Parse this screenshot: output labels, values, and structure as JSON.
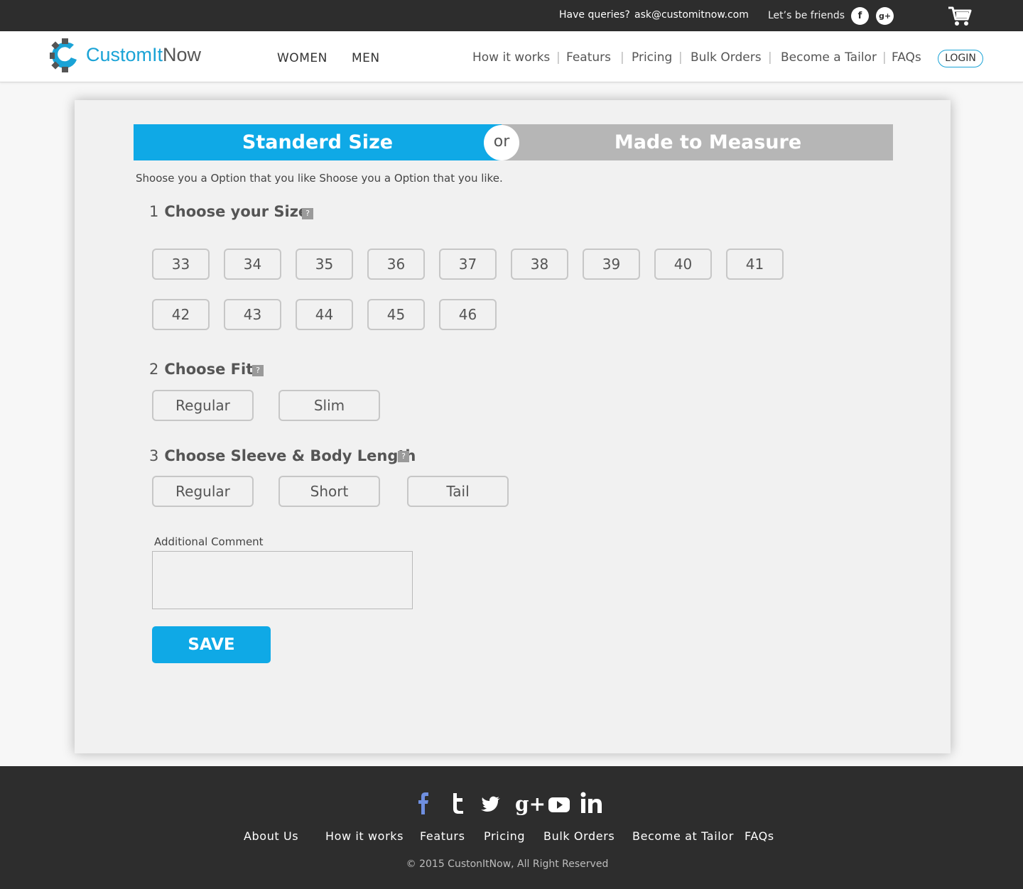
{
  "topbar": {
    "queries_label": "Have queries?",
    "email": "ask@customitnow.com",
    "friends_label": "Let’s be friends",
    "facebook_glyph": "f",
    "gplus_glyph": "g+"
  },
  "header": {
    "logo_part1": "CustomIt",
    "logo_part2": "Now",
    "gender": [
      "WOMEN",
      "MEN"
    ],
    "nav": [
      "How it works",
      "Featurs",
      "Pricing",
      "Bulk Orders",
      "Become a Tailor",
      "FAQs"
    ],
    "login": "LOGIN"
  },
  "toggle": {
    "left": "Standerd Size",
    "or": "or",
    "right": "Made to Measure"
  },
  "intro": "Shoose you a Option that you like Shoose you a Option that you like.",
  "help_glyph": "?",
  "sections": {
    "size": {
      "num": "1",
      "title": "Choose your Size",
      "options": [
        "33",
        "34",
        "35",
        "36",
        "37",
        "38",
        "39",
        "40",
        "41",
        "42",
        "43",
        "44",
        "45",
        "46"
      ]
    },
    "fit": {
      "num": "2",
      "title": "Choose Fit",
      "options": [
        "Regular",
        "Slim"
      ]
    },
    "sleeve": {
      "num": "3",
      "title": "Choose Sleeve & Body Length",
      "options": [
        "Regular",
        "Short",
        "Tail"
      ]
    }
  },
  "comment": {
    "label": "Additional Comment",
    "value": ""
  },
  "save": "SAVE",
  "footer": {
    "social": [
      "facebook-icon",
      "tumblr-icon",
      "twitter-icon",
      "google-plus-icon",
      "youtube-icon",
      "linkedin-icon"
    ],
    "links": [
      "About Us",
      "How it works",
      "Featurs",
      "Pricing",
      "Bulk Orders",
      "Become at Tailor",
      "FAQs"
    ],
    "copyright": "© 2015 CustonItNow, All Right Reserved"
  },
  "colors": {
    "accent": "#0fa9e6",
    "dark": "#2d2d2d",
    "inactive": "#b6b6b6"
  }
}
